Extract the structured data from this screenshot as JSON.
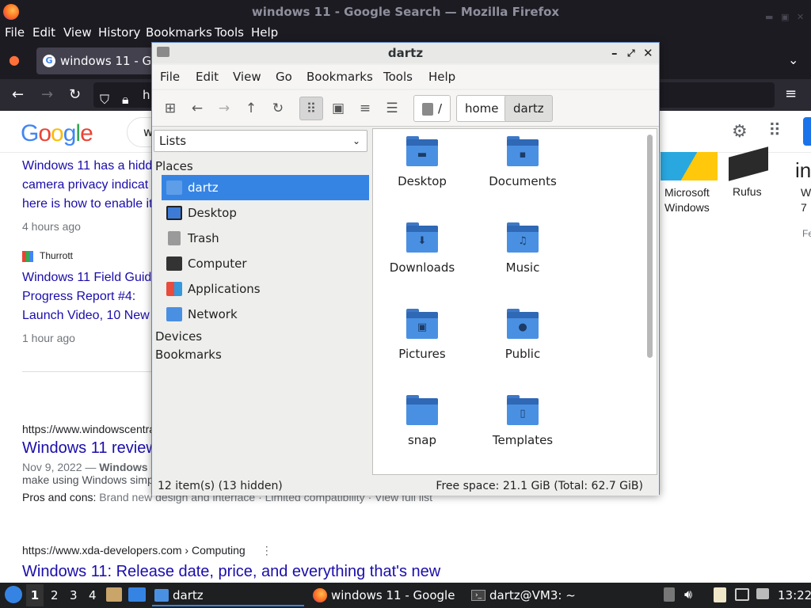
{
  "firefox": {
    "window_title": "windows 11 - Google Search — Mozilla Firefox",
    "menu": [
      "File",
      "Edit",
      "View",
      "History",
      "Bookmarks",
      "Tools",
      "Help"
    ],
    "tab_title": "windows 11 - Goo",
    "url_partial": "h"
  },
  "google": {
    "logo_text": "Google",
    "search_text": "w",
    "results": [
      {
        "title_lines": [
          "Windows 11 has a hidd",
          "camera privacy indicat",
          "here is how to enable it"
        ],
        "meta": "4 hours ago"
      },
      {
        "source": "Thurrott",
        "title_lines": [
          "Windows 11 Field Guid",
          "Progress Report #4:",
          "Launch Video, 10 New"
        ],
        "meta": "1 hour ago"
      },
      {
        "url": "https://www.windowscentra",
        "title": "Windows 11 review",
        "date": "Nov 9, 2022 —",
        "bold": "Windows",
        "snippet": "make using Windows simp",
        "pros": "Pros and cons:",
        "pros_detail": "Brand new design and interface · Limited compatibility · View full list"
      },
      {
        "url": "https://www.xda-developers.com › Computing",
        "title": "Windows 11: Release date, price, and everything that's new"
      }
    ],
    "right_items": [
      {
        "label_lines": [
          "Microsoft",
          "Windows"
        ]
      },
      {
        "label_lines": [
          "Rufus"
        ]
      },
      {
        "label_lines": [
          "W",
          "7"
        ]
      }
    ],
    "right_fe": "Fe",
    "right_in": "in"
  },
  "file_manager": {
    "title": "dartz",
    "menu": [
      "File",
      "Edit",
      "View",
      "Go",
      "Bookmarks",
      "Tools",
      "Help"
    ],
    "breadcrumbs": [
      "/",
      "home",
      "dartz"
    ],
    "side_select": "Lists",
    "sections": {
      "places": "Places",
      "devices": "Devices",
      "bookmarks": "Bookmarks"
    },
    "places": [
      {
        "label": "dartz",
        "icon": "home-folder-icon",
        "selected": true
      },
      {
        "label": "Desktop",
        "icon": "desktop-icon"
      },
      {
        "label": "Trash",
        "icon": "trash-icon"
      },
      {
        "label": "Computer",
        "icon": "computer-icon"
      },
      {
        "label": "Applications",
        "icon": "applications-icon"
      },
      {
        "label": "Network",
        "icon": "network-icon"
      }
    ],
    "items": [
      {
        "label": "Desktop",
        "glyph": "▬"
      },
      {
        "label": "Documents",
        "glyph": "▪"
      },
      {
        "label": "Downloads",
        "glyph": "⬇"
      },
      {
        "label": "Music",
        "glyph": "♫"
      },
      {
        "label": "Pictures",
        "glyph": "▣"
      },
      {
        "label": "Public",
        "glyph": "●"
      },
      {
        "label": "snap",
        "glyph": ""
      },
      {
        "label": "Templates",
        "glyph": "▯"
      }
    ],
    "status_left": "12 item(s) (13 hidden)",
    "status_right": "Free space: 21.1 GiB (Total: 62.7 GiB)"
  },
  "taskbar": {
    "workspaces": [
      "1",
      "2",
      "3",
      "4"
    ],
    "tasks": [
      {
        "label": "dartz",
        "active": true
      },
      {
        "label": "windows 11 - Google ..."
      },
      {
        "label": "dartz@VM3: ~"
      }
    ],
    "clock": "13:22"
  },
  "colors": {
    "accent": "#3584e4",
    "folder": "#4a90e2",
    "link": "#1a0dab"
  }
}
